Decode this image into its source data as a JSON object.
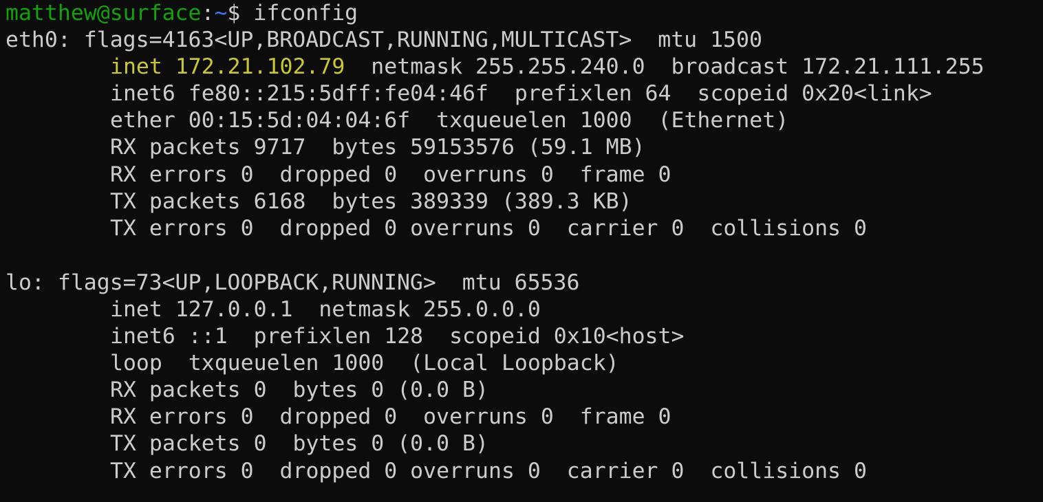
{
  "prompt": {
    "user_host": "matthew@surface",
    "separator": ":",
    "cwd": "~",
    "symbol": "$",
    "command": " ifconfig"
  },
  "interfaces": [
    {
      "header": "eth0: flags=4163<UP,BROADCAST,RUNNING,MULTICAST>  mtu 1500",
      "inet_highlight": "inet 172.21.102.79",
      "inet_rest": "  netmask 255.255.240.0  broadcast 172.21.111.255",
      "lines": [
        "inet6 fe80::215:5dff:fe04:46f  prefixlen 64  scopeid 0x20<link>",
        "ether 00:15:5d:04:04:6f  txqueuelen 1000  (Ethernet)",
        "RX packets 9717  bytes 59153576 (59.1 MB)",
        "RX errors 0  dropped 0  overruns 0  frame 0",
        "TX packets 6168  bytes 389339 (389.3 KB)",
        "TX errors 0  dropped 0 overruns 0  carrier 0  collisions 0"
      ]
    },
    {
      "header": "lo: flags=73<UP,LOOPBACK,RUNNING>  mtu 65536",
      "lines": [
        "inet 127.0.0.1  netmask 255.0.0.0",
        "inet6 ::1  prefixlen 128  scopeid 0x10<host>",
        "loop  txqueuelen 1000  (Local Loopback)",
        "RX packets 0  bytes 0 (0.0 B)",
        "RX errors 0  dropped 0  overruns 0  frame 0",
        "TX packets 0  bytes 0 (0.0 B)",
        "TX errors 0  dropped 0 overruns 0  carrier 0  collisions 0"
      ]
    }
  ],
  "colors": {
    "background": "#0c0c0c",
    "text": "#cccccc",
    "user_host": "#13a10e",
    "cwd": "#3b78ff",
    "highlight": "#c8c832"
  }
}
